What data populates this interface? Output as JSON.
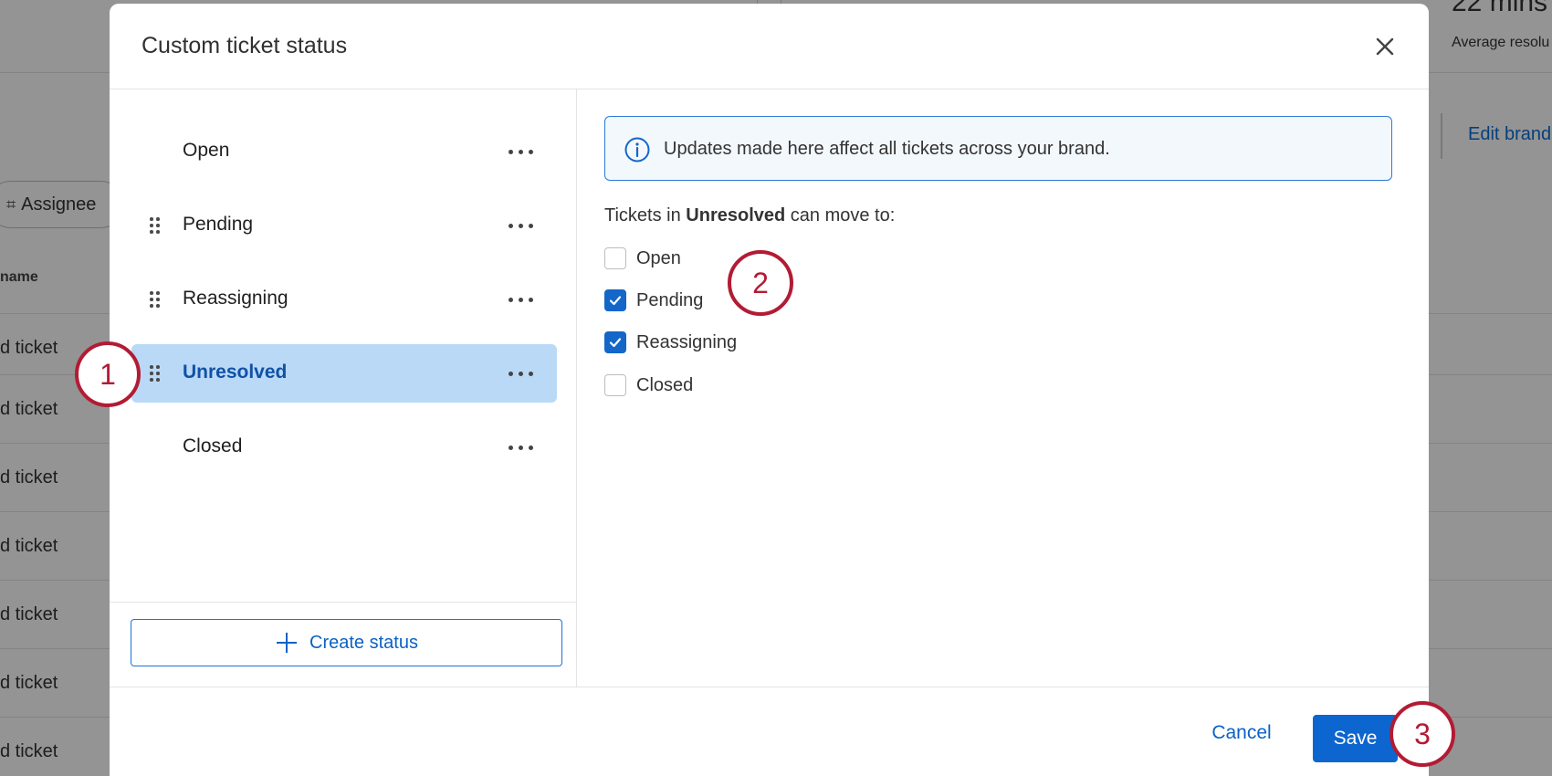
{
  "background": {
    "card_value": "22 mins",
    "card_subtitle": "Average resolu",
    "edit_link": "Edit brand",
    "filter_pill": "Assignee",
    "column_header": "name",
    "rows": [
      "d ticket",
      "d ticket",
      "d ticket",
      "d ticket",
      "d ticket",
      "d ticket",
      "d ticket"
    ]
  },
  "modal": {
    "title": "Custom ticket status",
    "statuses": [
      {
        "label": "Open",
        "draggable": false,
        "selected": false
      },
      {
        "label": "Pending",
        "draggable": true,
        "selected": false
      },
      {
        "label": "Reassigning",
        "draggable": true,
        "selected": false
      },
      {
        "label": "Unresolved",
        "draggable": true,
        "selected": true
      },
      {
        "label": "Closed",
        "draggable": false,
        "selected": false
      }
    ],
    "create_button": "Create status",
    "info_banner": "Updates made here affect all tickets across your brand.",
    "move_heading": {
      "prefix": "Tickets in ",
      "status": "Unresolved",
      "suffix": " can move to:"
    },
    "options": [
      {
        "label": "Open",
        "checked": false
      },
      {
        "label": "Pending",
        "checked": true
      },
      {
        "label": "Reassigning",
        "checked": true
      },
      {
        "label": "Closed",
        "checked": false
      }
    ],
    "cancel_button": "Cancel",
    "save_button": "Save"
  },
  "callouts": [
    "1",
    "2",
    "3"
  ],
  "colors": {
    "accent": "#0d66cf",
    "selected_row": "#b9d9f7",
    "callout": "#b31b34",
    "banner_border": "#2b7bd6"
  },
  "icons": {
    "close": "close-icon",
    "info": "info-icon",
    "plus": "plus-icon",
    "drag": "drag-handle-icon",
    "more": "more-horizontal-icon",
    "check": "check-icon",
    "pin": "pin-icon"
  }
}
